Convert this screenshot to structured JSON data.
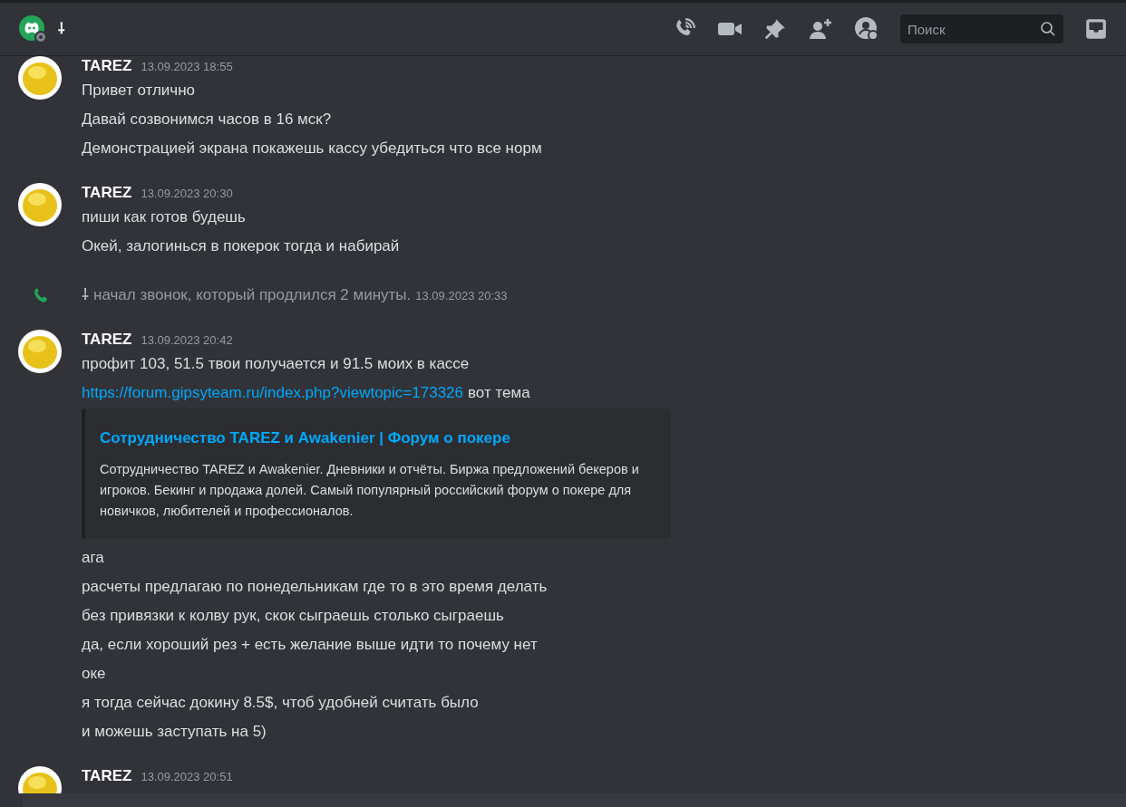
{
  "header": {
    "channel_name": "⸸",
    "search": {
      "placeholder": "Поиск"
    }
  },
  "messages": [
    {
      "kind": "group",
      "author": "TAREZ",
      "timestamp": "13.09.2023 18:55",
      "lines": [
        {
          "kind": "text",
          "text": "Привет отлично"
        },
        {
          "kind": "text",
          "text": "Давай созвонимся часов в 16 мск?"
        },
        {
          "kind": "text",
          "text": "Демонстрацией экрана покажешь кассу убедиться что все норм"
        }
      ]
    },
    {
      "kind": "group",
      "author": "TAREZ",
      "timestamp": "13.09.2023 20:30",
      "lines": [
        {
          "kind": "text",
          "text": "пиши как готов будешь"
        },
        {
          "kind": "text",
          "text": "Окей, залогинься в покерок тогда и набирай"
        }
      ]
    },
    {
      "kind": "call",
      "caller": "⸸",
      "text": "начал звонок, который продлился 2 минуты.",
      "timestamp": "13.09.2023 20:33"
    },
    {
      "kind": "group",
      "author": "TAREZ",
      "timestamp": "13.09.2023 20:42",
      "lines": [
        {
          "kind": "text",
          "text": "профит 103, 51.5 твои получается и 91.5 моих в кассе"
        },
        {
          "kind": "link",
          "link": "https://forum.gipsyteam.ru/index.php?viewtopic=173326",
          "text": "вот тема"
        },
        {
          "kind": "embed",
          "title": "Сотрудничество TAREZ и Awakenier | Форум о покере",
          "description": "Сотрудничество TAREZ и Awakenier. Дневники и отчёты. Биржа предложений бекеров и игроков. Бекинг и продажа долей. Самый популярный российский форум о покере для новичков, любителей и профессионалов."
        },
        {
          "kind": "text",
          "text": "ага"
        },
        {
          "kind": "text",
          "text": "расчеты предлагаю по понедельникам где то в это время делать"
        },
        {
          "kind": "text",
          "text": "без привязки к колву рук, скок сыграешь столько сыграешь"
        },
        {
          "kind": "text",
          "text": "да, если хороший рез + есть желание выше идти то почему нет"
        },
        {
          "kind": "text",
          "text": "оке"
        },
        {
          "kind": "text",
          "text": "я тогда сейчас докину 8.5$, чтоб удобней считать было"
        },
        {
          "kind": "text",
          "text": "и можешь заступать на 5)"
        }
      ]
    },
    {
      "kind": "group",
      "author": "TAREZ",
      "timestamp": "13.09.2023 20:51"
    }
  ]
}
